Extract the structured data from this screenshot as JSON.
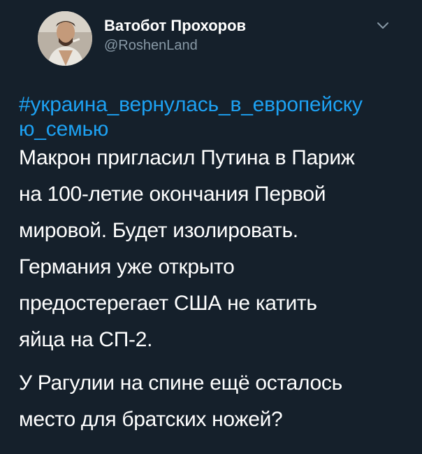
{
  "author": {
    "display_name": "Ватобот Прохоров",
    "handle": "@RoshenLand"
  },
  "tweet": {
    "hashtag": "#украина_вернулась_в_европейску\nю_семью",
    "paragraph1": "Макрон пригласил Путина в Париж\nна 100-летие окончания Первой\nмировой. Будет изолировать.\nГермания уже открыто\nпредостерегает США не катить\nяйца на СП-2.",
    "paragraph2": "У Рагулии на спине ещё осталось\nместо для братских ножей?"
  },
  "icons": {
    "menu": "chevron-down-icon",
    "avatar": "user-avatar"
  },
  "colors": {
    "background": "#15202b",
    "text": "#ffffff",
    "secondary": "#8899a6",
    "link": "#1da1f2"
  }
}
